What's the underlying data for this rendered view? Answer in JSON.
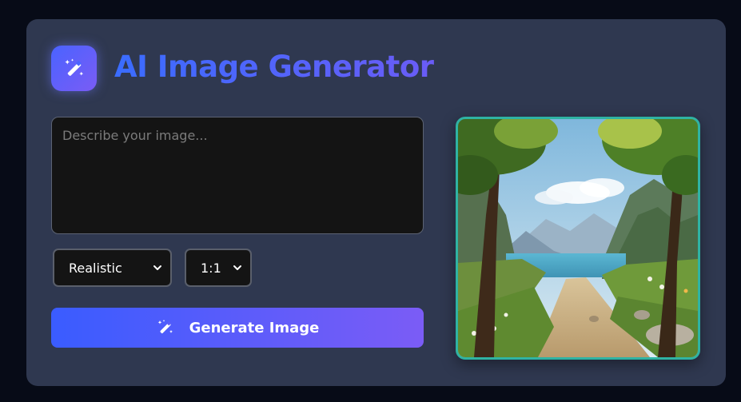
{
  "app": {
    "title": "AI Image Generator",
    "logo_icon": "magic-wand-icon"
  },
  "prompt": {
    "placeholder": "Describe your image...",
    "value": ""
  },
  "controls": {
    "style_select": {
      "selected": "Realistic",
      "icon": "chevron-down-icon"
    },
    "ratio_select": {
      "selected": "1:1",
      "icon": "chevron-down-icon"
    }
  },
  "generate_button": {
    "label": "Generate Image",
    "icon": "magic-wand-icon"
  },
  "preview": {
    "image": "forest-path-lake-mountains",
    "border_color": "#2fb3a3"
  },
  "colors": {
    "background": "#070b17",
    "card": "#2f3850",
    "accent_start": "#3a5cff",
    "accent_end": "#7b5cf6",
    "preview_border": "#2fb3a3"
  }
}
